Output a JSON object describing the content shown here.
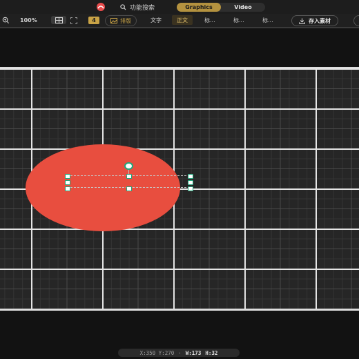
{
  "topbar": {
    "search_label": "功能搜索",
    "modes": [
      "Graphics",
      "Video"
    ],
    "active_mode": "Graphics"
  },
  "toolbar": {
    "zoom": "100%",
    "page_badge": "4",
    "layout_label": "排版",
    "tabs": [
      "文字",
      "正文",
      "标...",
      "标...",
      "标..."
    ],
    "active_tab": "正文",
    "save_label": "存入素材"
  },
  "canvas": {
    "shape_color": "#e84e3f",
    "handle_color": "#1fa87c"
  },
  "status": {
    "coords": "X:350 Y:270",
    "separator": "·",
    "width": "W:173",
    "height": "H:32"
  }
}
